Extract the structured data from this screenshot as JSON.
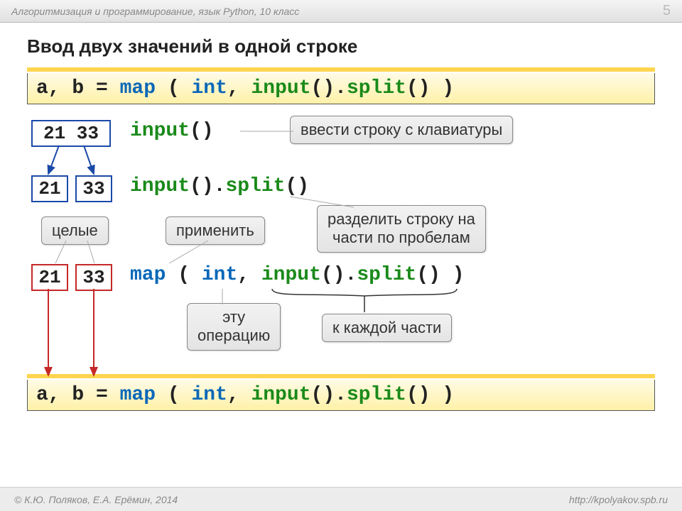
{
  "header": {
    "title": "Алгоритмизация и программирование, язык Python, 10 класс",
    "page": "5"
  },
  "slide_title": "Ввод двух значений в одной строке",
  "code_top": {
    "t1": "a, b = ",
    "t2": "map",
    "t3": " ( ",
    "t4": "int",
    "t5": ", ",
    "t6": "input",
    "t7": "()",
    "t8": ".",
    "t9": "split",
    "t10": "() )"
  },
  "row1": {
    "box": "21 33",
    "c1": "input",
    "c2": "()",
    "callout": "ввести строку с клавиатуры"
  },
  "row2": {
    "b1": "21",
    "b2": "33",
    "c1": "input",
    "c2": "()",
    "c3": ".",
    "c4": "split",
    "c5": "()"
  },
  "callouts": {
    "integers": "целые",
    "apply": "применить",
    "split_desc_l1": "разделить строку на",
    "split_desc_l2": "части по пробелам",
    "op_l1": "эту",
    "op_l2": "операцию",
    "each": "к каждой части"
  },
  "row3": {
    "b1": "21",
    "b2": "33",
    "t1": "map",
    "t2": " ( ",
    "t3": "int",
    "t4": ", ",
    "t5": "input",
    "t6": "()",
    "t7": ".",
    "t8": "split",
    "t9": "() )"
  },
  "footer": {
    "left": "© К.Ю. Поляков, Е.А. Ерёмин, 2014",
    "right": "http://kpolyakov.spb.ru"
  }
}
